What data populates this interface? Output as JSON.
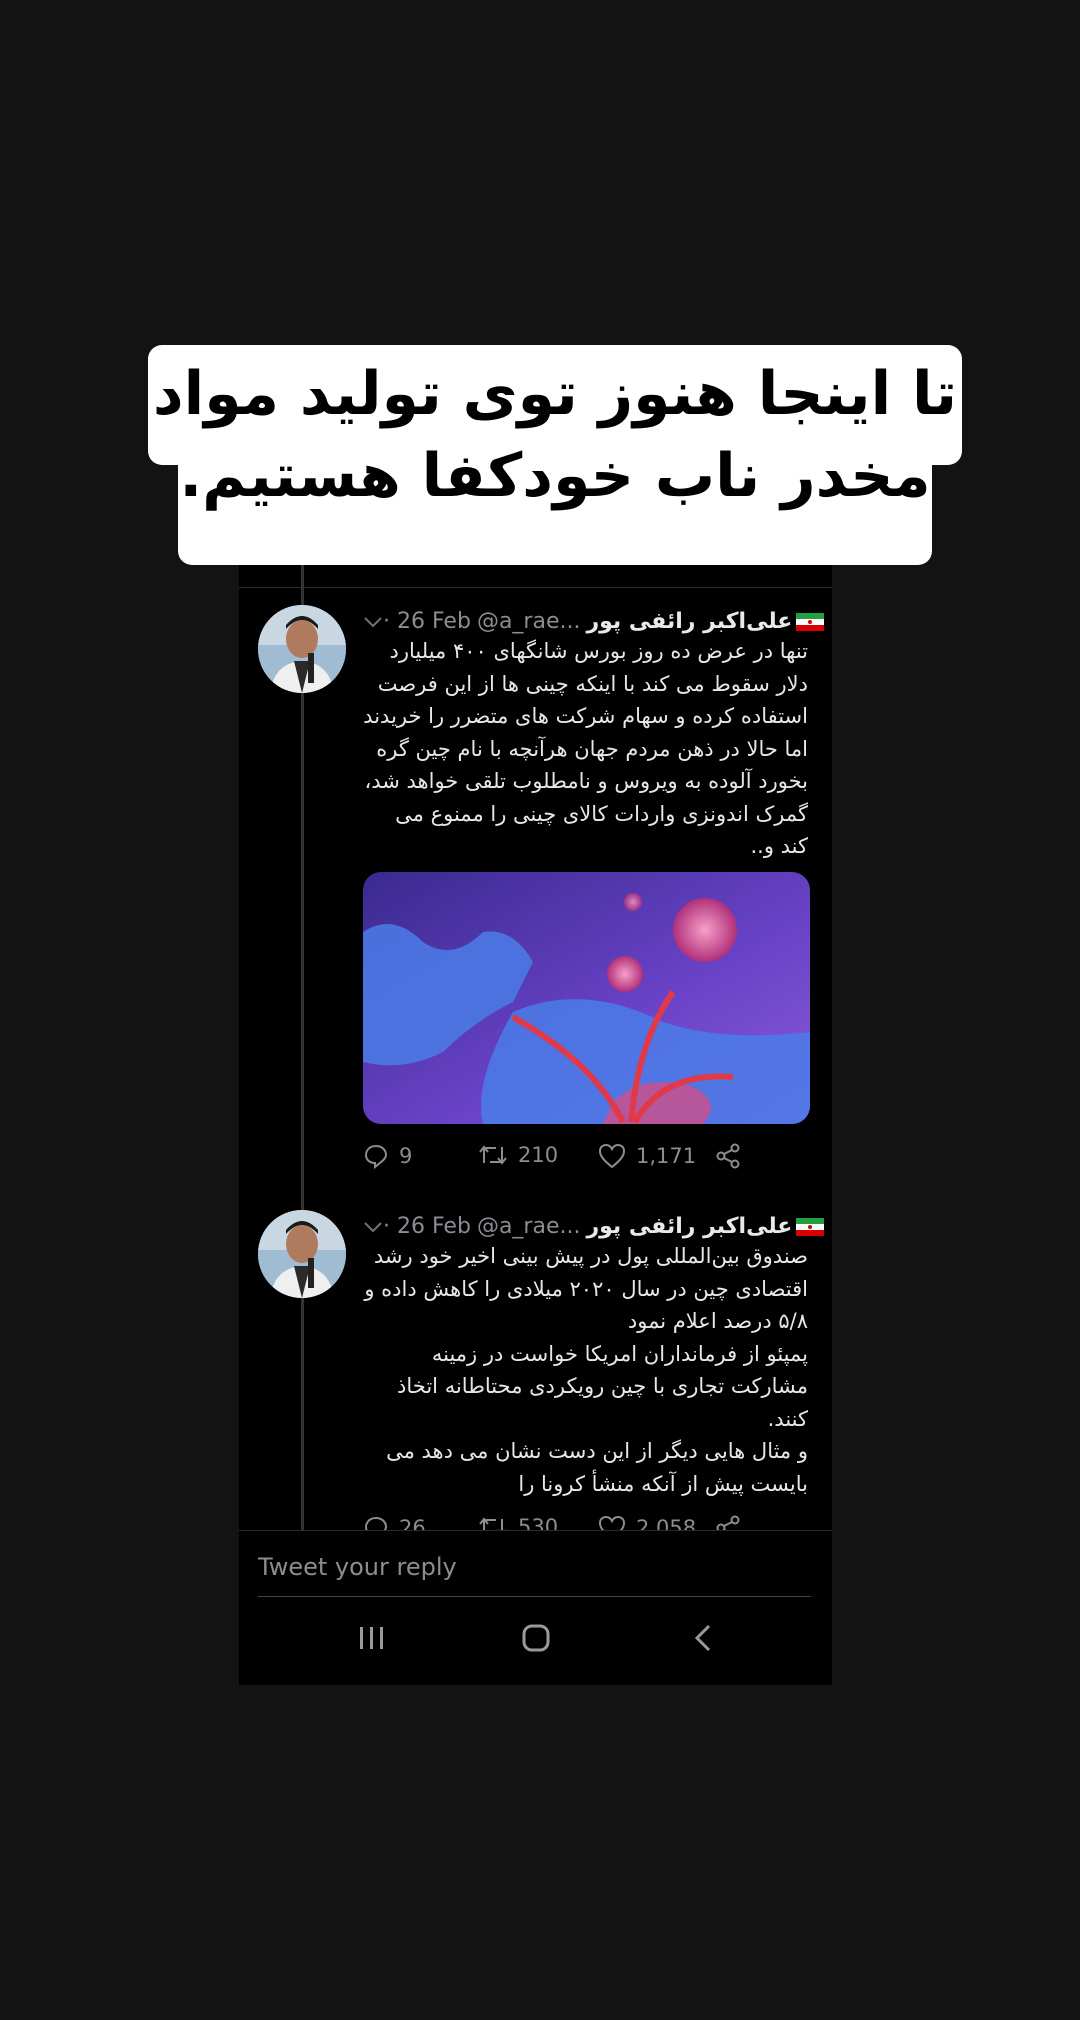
{
  "caption": "تا اینجا هنوز توی تولید مواد مخدر ناب خودکفا هستیم.",
  "tweets": [
    {
      "name": "علی‌اکبر رائفی پور",
      "handle": "@a_rae...",
      "date": "· 26 Feb",
      "text": "تنها در عرض ده روز بورس شانگهای ۴۰۰ میلیارد دلار سقوط می کند  با اینکه چینی ها از این فرصت استفاده کرده و سهام شرکت های متضرر را خریدند اما حالا در ذهن مردم جهان هرآنچه با نام چین گره بخورد آلوده به ویروس و نامطلوب تلقی خواهد شد، گمرک اندونزی واردات کالای چینی را ممنوع می کند و..",
      "replies": "9",
      "retweets": "210",
      "likes": "1,171"
    },
    {
      "name": "علی‌اکبر رائفی پور",
      "handle": "@a_rae...",
      "date": "· 26 Feb",
      "text": "صندوق بین‌المللی پول در پیش بینی اخیر خود رشد اقتصادی چین در سال ۲۰۲۰ میلادی را کاهش داده و ۵/۸ درصد اعلام نمود\nپمپئو از فرمانداران امریکا خواست در زمینه مشارکت تجاری با چین رویکردی محتاطانه اتخاذ کنند.\nو مثال هایی دیگر از این دست نشان می دهد می بایست پیش از آنکه منشأ کرونا را",
      "replies": "26",
      "retweets": "530",
      "likes": "2,058"
    }
  ],
  "reply_placeholder": "Tweet your reply",
  "icons": [
    "chevron-down-icon",
    "reply-icon",
    "retweet-icon",
    "like-icon",
    "share-icon",
    "recent-apps-icon",
    "home-icon",
    "back-icon",
    "iran-flag-icon"
  ]
}
